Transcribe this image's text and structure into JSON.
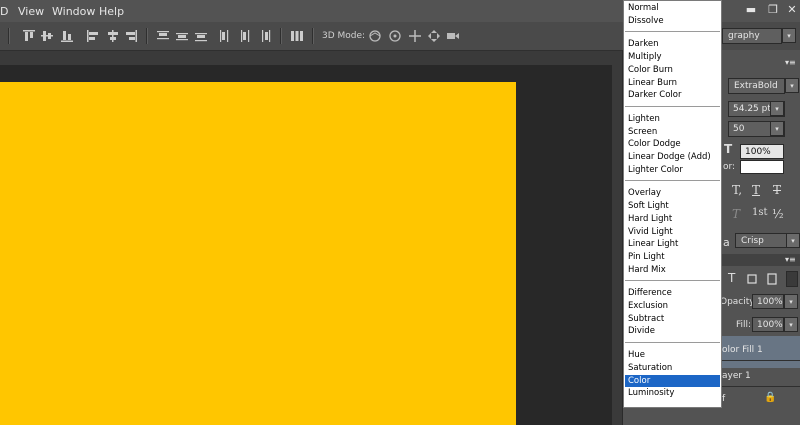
{
  "menubar": {
    "items": [
      "D",
      "View",
      "Window",
      "Help"
    ]
  },
  "options_bar": {
    "mode_3d_label": "3D Mode:"
  },
  "character_panel": {
    "font_style": "ExtraBold",
    "font_family_partial": "graphy",
    "font_size": "54.25 pt",
    "leading": "50",
    "vertical_scale": "100%",
    "color_label": "or:",
    "superscript_label": "1st",
    "fraction_label": "½",
    "antialias": "Crisp"
  },
  "layers_panel": {
    "opacity_label": "Opacity:",
    "opacity_value": "100%",
    "fill_label": "Fill:",
    "fill_value": "100%",
    "layers": [
      {
        "name": "olor Fill 1",
        "selected": true
      },
      {
        "name": "ayer 1",
        "selected": false
      },
      {
        "name": "f",
        "selected": false
      }
    ]
  },
  "blend_modes": {
    "groups": [
      [
        "Normal",
        "Dissolve"
      ],
      [
        "Darken",
        "Multiply",
        "Color Burn",
        "Linear Burn",
        "Darker Color"
      ],
      [
        "Lighten",
        "Screen",
        "Color Dodge",
        "Linear Dodge (Add)",
        "Lighter Color"
      ],
      [
        "Overlay",
        "Soft Light",
        "Hard Light",
        "Vivid Light",
        "Linear Light",
        "Pin Light",
        "Hard Mix"
      ],
      [
        "Difference",
        "Exclusion",
        "Subtract",
        "Divide"
      ],
      [
        "Hue",
        "Saturation",
        "Color",
        "Luminosity"
      ]
    ],
    "selected": "Color"
  },
  "colors": {
    "canvas_fill": "#ffc600",
    "selection_blue": "#1c66c6"
  }
}
